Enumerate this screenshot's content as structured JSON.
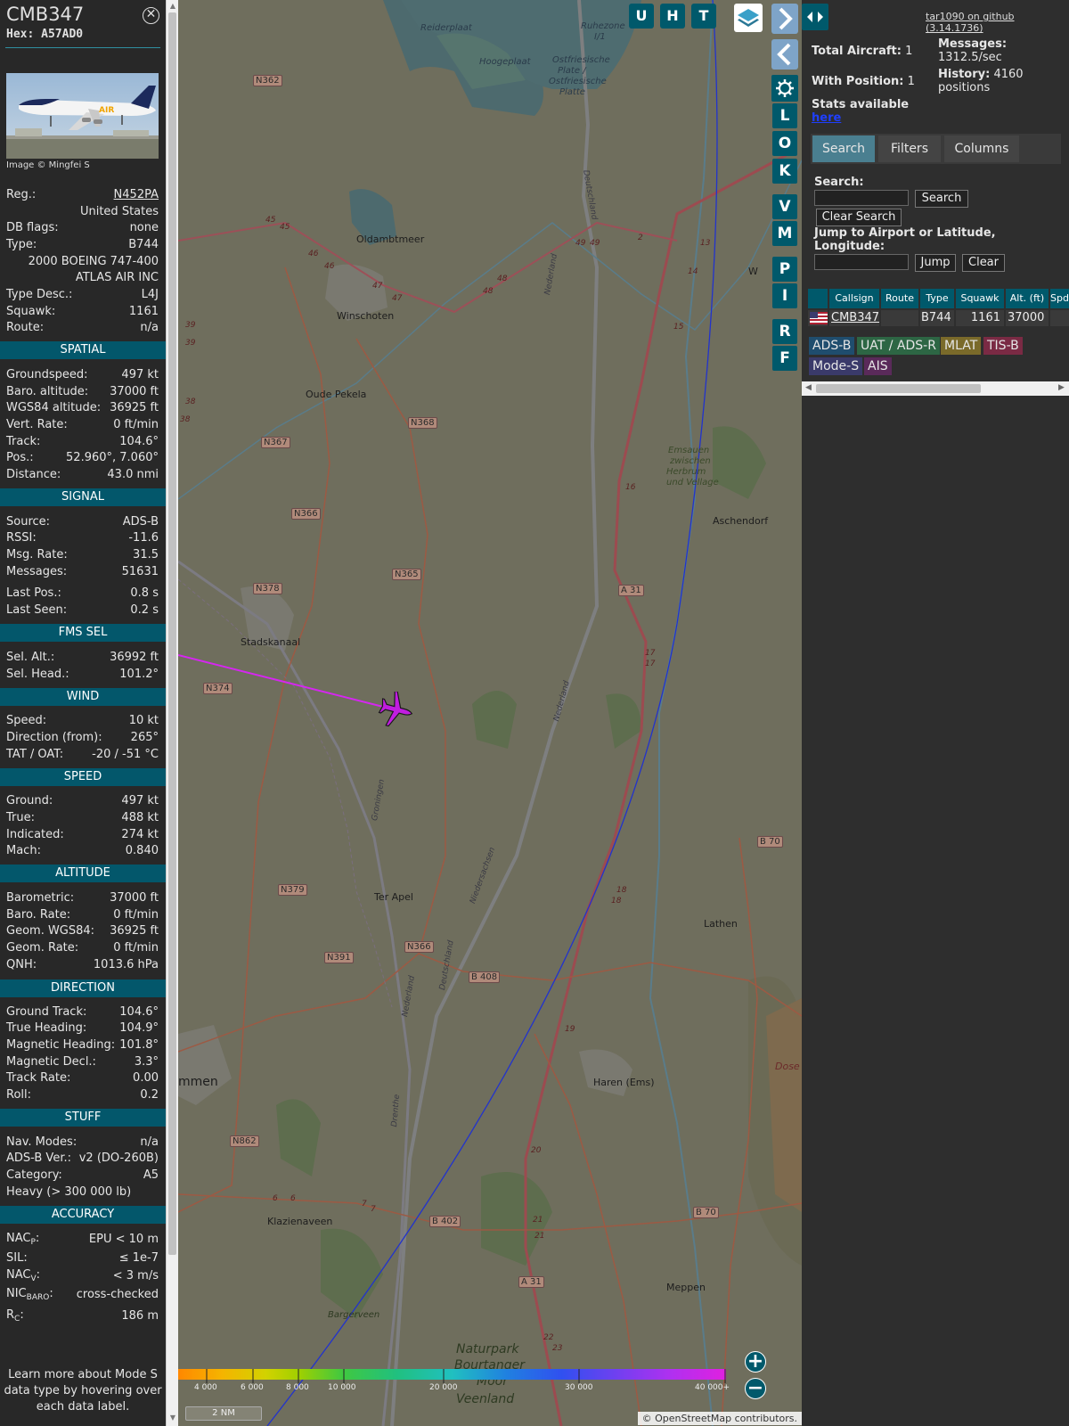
{
  "info": {
    "callsign": "CMB347",
    "hex": "Hex: A57AD0",
    "photo_credit": "Image © Mingfei S",
    "photo_livery_text": "AIR",
    "rows_top": [
      {
        "k": "Reg.:",
        "v": "N452PA",
        "link": true
      },
      {
        "k": "",
        "v": "United States"
      },
      {
        "k": "DB flags:",
        "v": "none"
      },
      {
        "k": "Type:",
        "v": "B744"
      },
      {
        "k": "",
        "v": "2000 BOEING 747-400"
      },
      {
        "k": "",
        "v": "ATLAS AIR INC"
      },
      {
        "k": "Type Desc.:",
        "v": "L4J"
      },
      {
        "k": "Squawk:",
        "v": "1161"
      },
      {
        "k": "Route:",
        "v": "n/a"
      }
    ],
    "spatial": {
      "title": "SPATIAL",
      "rows": [
        {
          "k": "Groundspeed:",
          "v": "497 kt"
        },
        {
          "k": "Baro. altitude:",
          "v": "37000 ft"
        },
        {
          "k": "WGS84 altitude:",
          "v": "36925 ft"
        },
        {
          "k": "Vert. Rate:",
          "v": "0 ft/min"
        },
        {
          "k": "Track:",
          "v": "104.6°"
        },
        {
          "k": "Pos.:",
          "v": "52.960°, 7.060°"
        },
        {
          "k": "Distance:",
          "v": "43.0 nmi"
        }
      ]
    },
    "signal": {
      "title": "SIGNAL",
      "rows": [
        {
          "k": "Source:",
          "v": "ADS-B"
        },
        {
          "k": "RSSI:",
          "v": "-11.6"
        },
        {
          "k": "Msg. Rate:",
          "v": "31.5"
        },
        {
          "k": "Messages:",
          "v": "51631"
        },
        {
          "k": "Last Pos.:",
          "v": "0.8 s"
        },
        {
          "k": "Last Seen:",
          "v": "0.2 s"
        }
      ]
    },
    "fms": {
      "title": "FMS SEL",
      "rows": [
        {
          "k": "Sel. Alt.:",
          "v": "36992 ft"
        },
        {
          "k": "Sel. Head.:",
          "v": "101.2°"
        }
      ]
    },
    "wind": {
      "title": "WIND",
      "rows": [
        {
          "k": "Speed:",
          "v": "10 kt"
        },
        {
          "k": "Direction (from):",
          "v": "265°"
        },
        {
          "k": "TAT / OAT:",
          "v": "-20 / -51 °C"
        }
      ]
    },
    "speed": {
      "title": "SPEED",
      "rows": [
        {
          "k": "Ground:",
          "v": "497 kt"
        },
        {
          "k": "True:",
          "v": "488 kt"
        },
        {
          "k": "Indicated:",
          "v": "274 kt"
        },
        {
          "k": "Mach:",
          "v": "0.840"
        }
      ]
    },
    "altitude": {
      "title": "ALTITUDE",
      "rows": [
        {
          "k": "Barometric:",
          "v": "37000 ft"
        },
        {
          "k": "Baro. Rate:",
          "v": "0 ft/min"
        },
        {
          "k": "Geom. WGS84:",
          "v": "36925 ft"
        },
        {
          "k": "Geom. Rate:",
          "v": "0 ft/min"
        },
        {
          "k": "QNH:",
          "v": "1013.6 hPa"
        }
      ]
    },
    "direction": {
      "title": "DIRECTION",
      "rows": [
        {
          "k": "Ground Track:",
          "v": "104.6°"
        },
        {
          "k": "True Heading:",
          "v": "104.9°"
        },
        {
          "k": "Magnetic Heading:",
          "v": "101.8°"
        },
        {
          "k": "Magnetic Decl.:",
          "v": "3.3°"
        },
        {
          "k": "Track Rate:",
          "v": "0.00"
        },
        {
          "k": "Roll:",
          "v": "0.2"
        }
      ]
    },
    "stuff": {
      "title": "STUFF",
      "rows": [
        {
          "k": "Nav. Modes:",
          "v": "n/a"
        },
        {
          "k": "ADS-B Ver.:",
          "v": "v2 (DO-260B)"
        },
        {
          "k": "Category:",
          "v": "A5"
        },
        {
          "k": "Heavy (> 300 000 lb)",
          "v": ""
        }
      ]
    },
    "accuracy": {
      "title": "ACCURACY",
      "rows": [
        {
          "k": "NAC",
          "sub": "P",
          "v": "EPU < 10 m"
        },
        {
          "k": "SIL:",
          "sub": "",
          "v": "≤ 1e-7"
        },
        {
          "k": "NAC",
          "sub": "V",
          "v": "< 3 m/s"
        },
        {
          "k": "NIC",
          "sub": "BARO",
          "v": "cross-checked"
        },
        {
          "k": "R",
          "sub": "C",
          "v": "186 m"
        }
      ]
    },
    "footer": "Learn more about Mode S data type by hovering over each data label."
  },
  "map": {
    "top_buttons": [
      "U",
      "H",
      "T"
    ],
    "side_buttons": [
      "L",
      "O",
      "K",
      "V",
      "M",
      "P",
      "I",
      "R",
      "F"
    ],
    "place_labels": [
      {
        "t": "Reiderplaat"
      },
      {
        "t": "Hoogeplaat"
      },
      {
        "t": "Ruhezone"
      },
      {
        "t": "I/1"
      },
      {
        "t": "Ostfriesische"
      },
      {
        "t": "Plate /"
      },
      {
        "t": "Ostfriesische"
      },
      {
        "t": "Platte"
      },
      {
        "t": "Oldambtmeer"
      },
      {
        "t": "Winschoten"
      },
      {
        "t": "Oude Pekela"
      },
      {
        "t": "Stadskanaal"
      },
      {
        "t": "Ter Apel"
      },
      {
        "t": "Aschendorf"
      },
      {
        "t": "Lathen"
      },
      {
        "t": "Haren (Ems)"
      },
      {
        "t": "Klazienaveen"
      },
      {
        "t": "Meppen"
      },
      {
        "t": "Emsauen"
      },
      {
        "t": "zwischen"
      },
      {
        "t": "Herbrum"
      },
      {
        "t": "und Vellage"
      },
      {
        "t": "Naturpark"
      },
      {
        "t": "Bourtanger"
      },
      {
        "t": "Moor"
      },
      {
        "t": "Veenland"
      },
      {
        "t": "Bargerveen"
      },
      {
        "t": "mmen"
      },
      {
        "t": "Dose"
      },
      {
        "t": "W"
      }
    ],
    "road_shields": [
      "N362",
      "N368",
      "N367",
      "N366",
      "N365",
      "N378",
      "N374",
      "N379",
      "N366",
      "N391",
      "B 408",
      "N862",
      "B 402",
      "A 31",
      "B 70",
      "A 31",
      "B 70"
    ],
    "road_numbers": [
      "45",
      "45",
      "46",
      "46",
      "47",
      "47",
      "48",
      "48",
      "49",
      "49",
      "2",
      "13",
      "14",
      "15",
      "16",
      "17",
      "17",
      "18",
      "18",
      "19",
      "20",
      "21",
      "21",
      "22",
      "23",
      "39",
      "39",
      "38",
      "38",
      "6",
      "6",
      "7",
      "7"
    ],
    "road_names": [
      "Deutschland",
      "Nederland",
      "Nederland",
      "Groningen",
      "Niedersachsen",
      "Deutschland",
      "Nederland",
      "Drenthe"
    ],
    "altitude_scale": [
      "4 000",
      "6 000",
      "8 000",
      "10 000",
      "20 000",
      "30 000",
      "40 000+"
    ],
    "scale_label": "2 NM",
    "attribution": "© OpenStreetMap contributors.",
    "attribution_link": "OpenStreetMap",
    "zoom_in": "+",
    "zoom_out": "−"
  },
  "sidebar": {
    "version_link": "tar1090 on github (3.14.1736)",
    "total_aircraft_label": "Total Aircraft:",
    "total_aircraft": "1",
    "with_position_label": "With Position:",
    "with_position": "1",
    "messages_label": "Messages:",
    "messages_rate": "1312.5/sec",
    "history_label": "History:",
    "history_value": "4160",
    "history_unit": "positions",
    "stats_label": "Stats available",
    "stats_link": "here",
    "tabs": [
      "Search",
      "Filters",
      "Columns"
    ],
    "search_label": "Search:",
    "search_button": "Search",
    "clear_search_button": "Clear Search",
    "jump_label": "Jump to Airport or Latitude, Longitude:",
    "jump_button": "Jump",
    "clear_button": "Clear",
    "table": {
      "headers": [
        "Callsign",
        "Route",
        "Type",
        "Squawk",
        "Alt. (ft)",
        "Spd."
      ],
      "rows": [
        {
          "callsign": "CMB347",
          "route": "",
          "type": "B744",
          "squawk": "1161",
          "alt": "37000"
        }
      ]
    },
    "sources": [
      {
        "label": "ADS-B",
        "color": "#1f4d6e"
      },
      {
        "label": "UAT / ADS-R",
        "color": "#2d6644"
      },
      {
        "label": "MLAT",
        "color": "#7a6a2a"
      },
      {
        "label": "TIS-B",
        "color": "#7a2a44"
      },
      {
        "label": "Mode-S",
        "color": "#3a3a6a"
      },
      {
        "label": "AIS",
        "color": "#5a2a5a"
      }
    ]
  }
}
